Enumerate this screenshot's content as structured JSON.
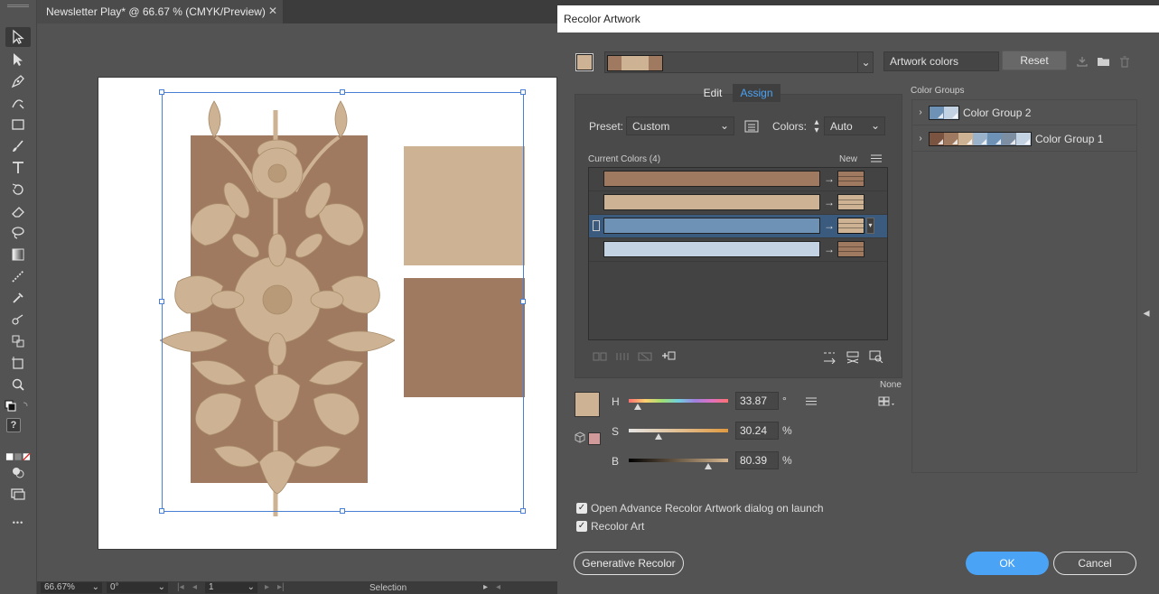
{
  "document": {
    "tab_title": "Newsletter Play* @ 66.67 % (CMYK/Preview)",
    "close_glyph": "✕"
  },
  "statusbar": {
    "zoom": "66.67%",
    "rotation": "0°",
    "artboard_number": "1",
    "tool_name": "Selection"
  },
  "toolbar": {
    "help_glyph": "?",
    "more_glyph": "•••"
  },
  "dialog": {
    "title": "Recolor Artwork",
    "artwork_colors": "Artwork colors",
    "reset": "Reset",
    "tabs": {
      "edit": "Edit",
      "assign": "Assign"
    },
    "preset_label": "Preset:",
    "preset_value": "Custom",
    "colors_label": "Colors:",
    "colors_value": "Auto",
    "current_colors": "Current Colors (4)",
    "new_label": "New",
    "rows": [
      {
        "current": "#a07a60",
        "new": "#a07a60"
      },
      {
        "current": "#cdb393",
        "new": "#cdb393"
      },
      {
        "current": "#6e92b6",
        "new": "#cdb393"
      },
      {
        "current": "#c4d3e4",
        "new": "#a07a60"
      }
    ],
    "hsb": {
      "h_label": "H",
      "h_value": "33.87",
      "h_unit": "°",
      "h_level": 0.094,
      "s_label": "S",
      "s_value": "30.24",
      "s_unit": "%",
      "s_level": 0.3024,
      "b_label": "B",
      "b_value": "80.39",
      "b_unit": "%",
      "b_level": 0.8039
    },
    "none_label": "None",
    "color_groups_label": "Color Groups",
    "color_groups": [
      {
        "name": "Color Group 2",
        "swatches": [
          "#6e92b6",
          "#c4d3e4"
        ]
      },
      {
        "name": "Color Group 1",
        "swatches": [
          "#7a5440",
          "#a07a60",
          "#cdb393",
          "#9bb3ca",
          "#6e92b6",
          "#7d8ea2",
          "#c4d3e4"
        ]
      }
    ],
    "opt_advance": "Open Advance Recolor Artwork dialog on launch",
    "opt_recolor": "Recolor Art",
    "generative_recolor": "Generative Recolor",
    "ok": "OK",
    "cancel": "Cancel",
    "check_glyph": "✓"
  },
  "colors": {
    "brown": "#a07a60",
    "tan": "#cdb393",
    "blue": "#6e92b6",
    "light_blue": "#c4d3e4",
    "accent": "#4aa3f5"
  }
}
